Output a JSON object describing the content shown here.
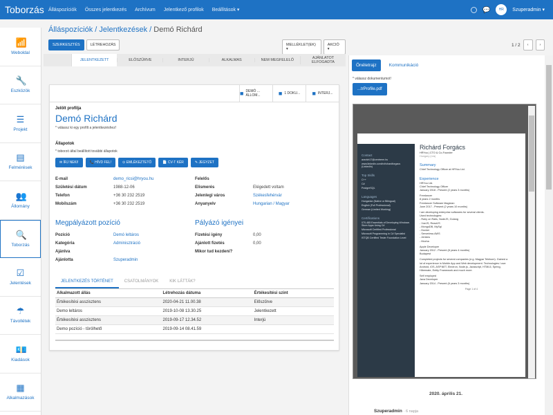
{
  "app": {
    "brand": "Toborzás",
    "nav": [
      "Álláspozíciók",
      "Összes jelentkezés",
      "Archívum",
      "Jelentkező profilok",
      "Beállítások ▾"
    ],
    "user": "Szuperadmin ▾",
    "avatar_text": "HR"
  },
  "sidebar": [
    {
      "label": "Weboldal",
      "icon": "wifi-icon",
      "glyph": "📶"
    },
    {
      "label": "Eszközök",
      "icon": "wrench-icon",
      "glyph": "🔧"
    },
    {
      "label": "Projekt",
      "icon": "list-icon",
      "glyph": "☰"
    },
    {
      "label": "Felmérések",
      "icon": "database-icon",
      "glyph": "▤"
    },
    {
      "label": "Állomány",
      "icon": "users-icon",
      "glyph": "👥"
    },
    {
      "label": "Toborzás",
      "icon": "search-icon",
      "glyph": "🔍"
    },
    {
      "label": "Jelentések",
      "icon": "checkbox-icon",
      "glyph": "☑"
    },
    {
      "label": "Távollétek",
      "icon": "umbrella-icon",
      "glyph": "☂"
    },
    {
      "label": "Kiadások",
      "icon": "money-icon",
      "glyph": "💶"
    },
    {
      "label": "Alkalmazások",
      "icon": "grid-icon",
      "glyph": "▦"
    }
  ],
  "breadcrumb": {
    "a": "Álláspozíciók",
    "b": "Jelentkezések",
    "c": "Demó Richárd",
    "sep": "/"
  },
  "toolbar": {
    "edit": "SZERKESZTÉS",
    "create": "LÉTREHOZÁS",
    "attachments": "MELLÉKLET(EK) ▾",
    "action": "AKCIÓ ▾",
    "pager": "1 / 2"
  },
  "steps": [
    "JELENTKEZETT",
    "ELŐSZŰRVE",
    "INTERJÚ",
    "ALKALMAS",
    "NEM MEGFELELŐ",
    "AJÁNLATOT ELFOGADTA"
  ],
  "cardhead": [
    {
      "text": "DEMÓ ... ÁLLOM...",
      "icon": "user-icon"
    },
    {
      "text": "1 DOKU...",
      "icon": "book-icon"
    },
    {
      "text": "INTERJ...",
      "icon": "calendar-icon"
    }
  ],
  "profile": {
    "section": "Jelölt profilja",
    "name": "Demó Richárd",
    "note": "* válassz ki egy profilt a jelentkezéshez!"
  },
  "states": {
    "title": "Állapotok",
    "note": "* toborzó által beállított további állapotok",
    "buttons": [
      "✉ ÍRJ NEKI!",
      "📞 HÍVD FEL!",
      "⊙ EMLÉKEZTETŐ",
      "📄 CV-T KÉR",
      "✎ JEGYZET"
    ]
  },
  "details_left": [
    {
      "k": "E-mail",
      "v": "demo_ricsi@hryou.hu",
      "link": true
    },
    {
      "k": "Születési dátum",
      "v": "1988-12-06"
    },
    {
      "k": "Telefon",
      "v": "+36 30 232 2519"
    },
    {
      "k": "Mobilszám",
      "v": "+36 30 232 2519"
    }
  ],
  "details_right": [
    {
      "k": "Felelős",
      "v": ""
    },
    {
      "k": "Elismerés",
      "v": "Elégedett voltam"
    },
    {
      "k": "Jelenlegi város",
      "v": "Székesfehérvár",
      "link": true
    },
    {
      "k": "Anyanyelv",
      "v": "Hungarian / Magyar",
      "link": true
    }
  ],
  "position": {
    "title": "Megpályázott pozíció",
    "rows": [
      {
        "k": "Pozíció",
        "v": "Demó leltáros",
        "link": true
      },
      {
        "k": "Kategória",
        "v": "Adminisztráció",
        "link": true
      },
      {
        "k": "Ajánlva",
        "v": ""
      },
      {
        "k": "Ajánlotta",
        "v": "Szuperadmin",
        "link": true
      }
    ]
  },
  "claims": {
    "title": "Pályázó igényei",
    "rows": [
      {
        "k": "Fizetési igény",
        "v": "0,00"
      },
      {
        "k": "Ajánlott fizetés",
        "v": "0,00"
      },
      {
        "k": "Mikor tud kezdeni?",
        "v": ""
      }
    ]
  },
  "history": {
    "tabs": [
      "JELENTKEZÉS TÖRTÉNET",
      "CSATOLMÁNYOK",
      "KIK LÁTTÁK?"
    ],
    "headers": [
      "Alkalmazott állás",
      "Létrehozás dátuma",
      "Értékesítési szint"
    ],
    "rows": [
      [
        "Értékesítési asszisztens",
        "2020-04-21 11.00.38",
        "Előszűrve"
      ],
      [
        "Demo leltáros",
        "2019-10-08 13.30.25",
        "Jelentkezett"
      ],
      [
        "Értékesítési asszisztens",
        "2019-09-17 12.34.52",
        "Interjú"
      ],
      [
        "Demo pozíció - törölhető",
        "2019-09-14 08.41.59",
        ""
      ]
    ]
  },
  "right": {
    "tabs": [
      "Önéletrajz",
      "Kommunikáció"
    ],
    "note": "* válassz dokumentumot!",
    "file": "...trProfile.pdf",
    "cv": {
      "name": "Richárd Forgács",
      "subtitle": "HRYou | CTO & Co-Founder",
      "loc": "Hungary (n/a)",
      "summary_h": "Summary",
      "summary": "Chief Technology Officer at HRYou Ltd.",
      "exp_h": "Experience",
      "exp": [
        "HRYou Ltd.",
        "Chief Technology Officer",
        "January 2018 - Present (2 years 3 months)",
        "",
        "Freelancer",
        "8 years 2 months",
        "Freelancer Software Magician",
        "June 2017 - Present (2 years 10 months)",
        "",
        "I am developing enterprise softwares for several clients.",
        "Used technologies:",
        "- Ruby on Rails, NodeJS, Golang",
        "- VueJS, ReactJS",
        "- MongoDB, MySql",
        "- Docker",
        "- Serverless AWS",
        "- Jenkins",
        "- Mocha",
        "",
        "Apple Developer",
        "January 2012 - Present (8 years 4 months)",
        "Budapest",
        "",
        "Completed projects for several companies (e.g. Magyar Telekom). Gained a",
        "lot of experience in Mobile App and Web development. Technologies I use:",
        "Android, iOS, ASP.NET, Electron, Node.js, Javascript, HTML5, Spring,",
        "Hibernate, Entity Framework and much more.",
        "",
        "Self employed",
        "Java Developer",
        "January 2014 - Present (6 years 3 months)"
      ],
      "page": "Page 1 of 4",
      "left": [
        "Contact",
        "acsrich17@centrerm.hu",
        "www.linkedin.com/in/richardforgacs (LinkedIn)",
        "Top Skills",
        "C++",
        "C#",
        "PostgreSQL",
        "Languages",
        "Hungarian (Native or Bilingual)",
        "English (Full Professional)",
        "German (Limited Working)",
        "Certifications",
        "070-485 Essentials of Developing Windows Store Apps Using C#",
        "Microsoft Certified Professional",
        "Microsoft Programming in C# Specialist",
        "ISTQB Certified Tester Foundation Level"
      ]
    },
    "date": "2020. április 21.",
    "author": "Szuperadmin",
    "ago": "· 6 napja"
  }
}
